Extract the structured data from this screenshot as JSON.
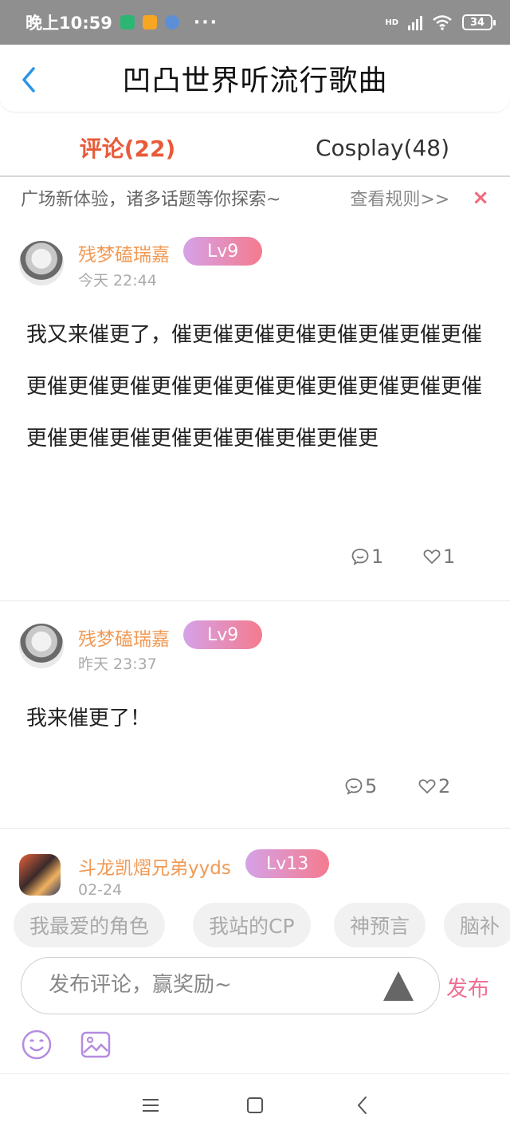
{
  "status_bar": {
    "time": "晚上10:59",
    "battery": "34",
    "dots": "···",
    "network_label": "HD"
  },
  "header": {
    "title": "凹凸世界听流行歌曲",
    "back_icon": "chevron-left-icon"
  },
  "tabs": [
    {
      "label": "评论(22)",
      "active": true
    },
    {
      "label": "Cosplay(48)",
      "active": false
    }
  ],
  "notice": {
    "text": "广场新体验，诸多话题等你探索~",
    "link": "查看规则>>",
    "close": "×"
  },
  "comments": [
    {
      "username": "残梦磕瑞嘉",
      "level": "Lv9",
      "time": "今天 22:44",
      "text": "我又来催更了，催更催更催更催更催更催更催更催更催更催更催更催更催更催更催更催更催更催更催更催更催更催更催更催更催更催更催更",
      "replies": "1",
      "likes": "1"
    },
    {
      "username": "残梦磕瑞嘉",
      "level": "Lv9",
      "time": "昨天 23:37",
      "text": "我来催更了！",
      "replies": "5",
      "likes": "2"
    },
    {
      "username": "斗龙凯熠兄弟yyds",
      "level": "Lv13",
      "time": "02-24"
    }
  ],
  "tags": [
    "我最爱的角色",
    "我站的CP",
    "神预言",
    "脑补"
  ],
  "composer": {
    "placeholder": "发布评论，赢奖励~",
    "publish": "发布"
  },
  "colors": {
    "accent": "#e85b3a",
    "username": "#f19a55",
    "publish": "#ef6f92",
    "badge_start": "#d5a2e8",
    "badge_end": "#f47b8e"
  }
}
